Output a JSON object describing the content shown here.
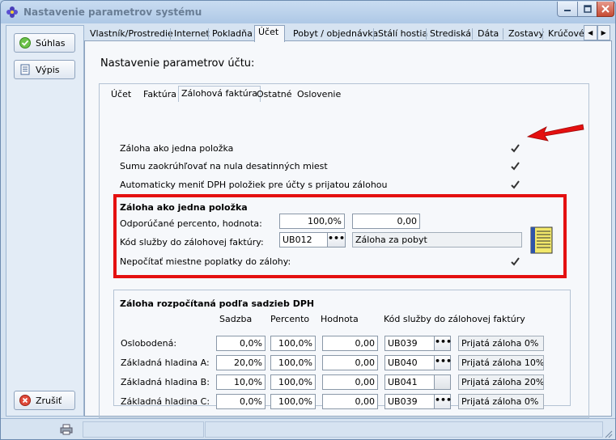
{
  "window": {
    "title": "Nastavenie parametrov systému"
  },
  "sidebar": {
    "confirm_label": "Súhlas",
    "list_label": "Výpis",
    "cancel_label": "Zrušiť"
  },
  "tabs": [
    "Vlastník/Prostredie",
    "Internet",
    "Pokladňa",
    "Účet",
    "Pobyt / objednávka",
    "Stálí hostia",
    "Strediská",
    "Dáta",
    "Zostavy",
    "Krúčové"
  ],
  "active_tab": "Účet",
  "page": {
    "title": "Nastavenie parametrov účtu:",
    "subtabs": [
      "Účet",
      "Faktúra",
      "Zálohová faktúra",
      "Ostatné",
      "Oslovenie"
    ],
    "active_subtab": "Zálohová faktúra",
    "options": [
      {
        "label": "Záloha ako jedna položka",
        "checked": true
      },
      {
        "label": "Sumu zaokrúhľovať na nula desatinných miest",
        "checked": true
      },
      {
        "label": "Automaticky meniť DPH položiek pre účty s prijatou zálohou",
        "checked": true
      }
    ],
    "single_item": {
      "title": "Záloha ako jedna položka",
      "percent_label": "Odporúčané percento, hodnota:",
      "percent_value": "100,0%",
      "amount_value": "0,00",
      "service_label": "Kód služby do zálohovej faktúry:",
      "service_code": "UB012",
      "service_name": "Záloha za pobyt",
      "local_fees_label": "Nepočítať miestne poplatky do zálohy:",
      "local_fees_checked": true
    },
    "vat_split": {
      "title": "Záloha rozpočítaná podľa sadzieb DPH",
      "headers": {
        "rate": "Sadzba",
        "percent": "Percento",
        "value": "Hodnota",
        "code": "Kód služby do zálohovej faktúry"
      },
      "rows": [
        {
          "name": "Oslobodená:",
          "rate": "0,0%",
          "percent": "100,0%",
          "value": "0,00",
          "code": "UB039",
          "desc": "Prijatá záloha 0%"
        },
        {
          "name": "Základná hladina A:",
          "rate": "20,0%",
          "percent": "100,0%",
          "value": "0,00",
          "code": "UB040",
          "desc": "Prijatá záloha 10%"
        },
        {
          "name": "Základná hladina B:",
          "rate": "10,0%",
          "percent": "100,0%",
          "value": "0,00",
          "code": "UB041",
          "desc": "Prijatá záloha 20%"
        },
        {
          "name": "Základná hladina C:",
          "rate": "0,0%",
          "percent": "100,0%",
          "value": "0,00",
          "code": "UB039",
          "desc": "Prijatá záloha 0%"
        }
      ]
    }
  },
  "dots_label": "•••",
  "colors": {
    "highlight": "#e41010",
    "accent": "#1f4f8f"
  }
}
